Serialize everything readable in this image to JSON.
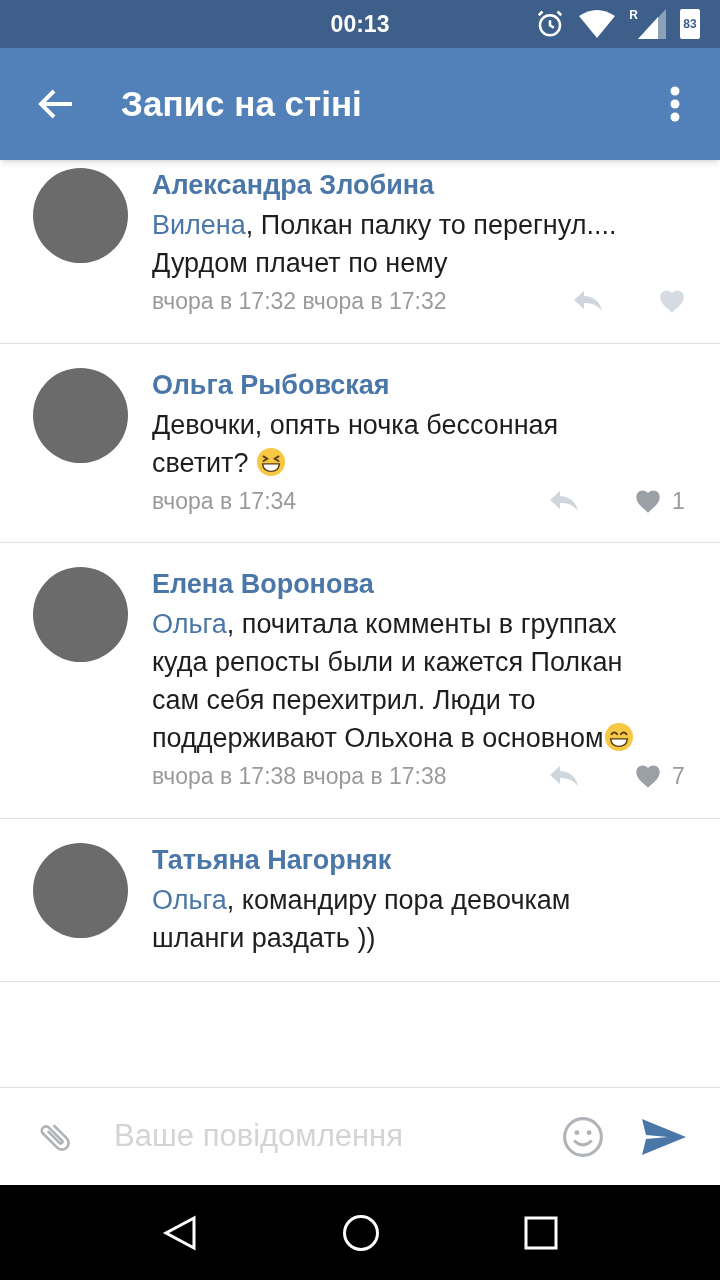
{
  "status_bar": {
    "time": "00:13",
    "battery": "83",
    "roaming": "R"
  },
  "app_bar": {
    "title": "Запис на стіні"
  },
  "comments": [
    {
      "author": "Александра Злобина",
      "mention": "Вилена",
      "text": ", Полкан палку то перегнул.... Дурдом плачет по нему",
      "time": "вчора в 17:32 вчора в 17:32"
    },
    {
      "author": "Ольга Рыбовская",
      "text": "Девочки, опять ночка бессонная светит? ",
      "emoji": {
        "kind": "squint"
      },
      "time": "вчора в 17:34",
      "likes": "1"
    },
    {
      "author": "Елена Воронова",
      "mention": "Ольга",
      "text": ", почитала комменты в группах куда репосты были и кажется Полкан сам себя перехитрил. Люди то поддерживают Ольхона в основном",
      "emoji": {
        "kind": "grin"
      },
      "time": "вчора в 17:38 вчора в 17:38",
      "likes": "7"
    },
    {
      "author": "Татьяна Нагорняк",
      "mention": "Ольга",
      "text": ", командиру пора девочкам шланги раздать ))"
    }
  ],
  "composer": {
    "placeholder": "Ваше повідомлення"
  }
}
